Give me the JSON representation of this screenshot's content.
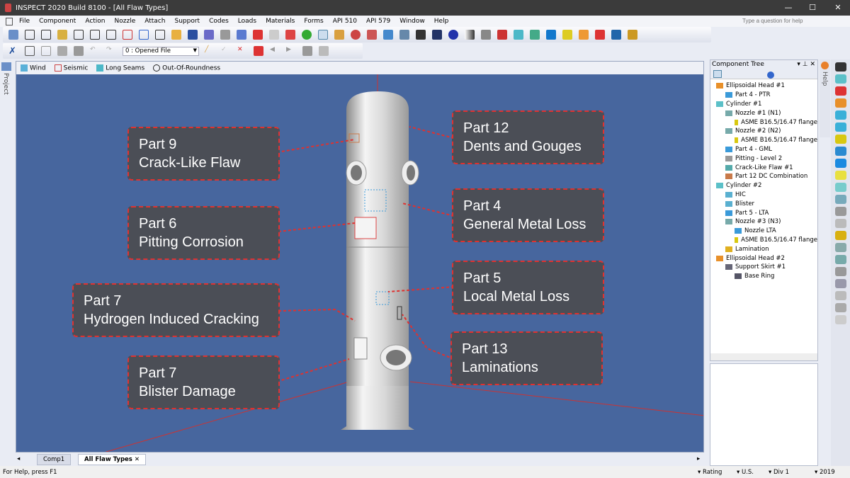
{
  "window": {
    "title": "INSPECT 2020 Build 8100 - [All Flaw Types]",
    "help_search_placeholder": "Type a question for help"
  },
  "menu": [
    "File",
    "Component",
    "Action",
    "Nozzle",
    "Attach",
    "Support",
    "Codes",
    "Loads",
    "Materials",
    "Forms",
    "API 510",
    "API 579",
    "Window",
    "Help"
  ],
  "toolbar2": {
    "history_select": "0 : Opened File"
  },
  "viewport_toolbar": [
    {
      "label": "Wind",
      "icon": "wind-icon"
    },
    {
      "label": "Seismic",
      "icon": "seismic-icon"
    },
    {
      "label": "Long Seams",
      "icon": "long-seams-icon"
    },
    {
      "label": "Out-Of-Roundness",
      "icon": "circle-icon"
    }
  ],
  "callouts": [
    {
      "part": "Part 9",
      "name": "Crack-Like Flaw"
    },
    {
      "part": "Part 12",
      "name": "Dents and Gouges"
    },
    {
      "part": "Part 6",
      "name": "Pitting Corrosion"
    },
    {
      "part": "Part 4",
      "name": "General Metal Loss"
    },
    {
      "part": "Part 7",
      "name": "Hydrogen Induced Cracking"
    },
    {
      "part": "Part 5",
      "name": "Local Metal Loss"
    },
    {
      "part": "Part 7",
      "name": "Blister Damage"
    },
    {
      "part": "Part 13",
      "name": "Laminations"
    }
  ],
  "side_labels": {
    "project": "Project",
    "help": "Help"
  },
  "component_tree": {
    "title": "Component Tree",
    "nodes": [
      {
        "label": "Ellipsoidal Head #1",
        "level": 0,
        "color": "#e8902a"
      },
      {
        "label": "Part 4 - PTR",
        "level": 1,
        "color": "#3a9ad9"
      },
      {
        "label": "Cylinder #1",
        "level": 0,
        "color": "#5cc0c8"
      },
      {
        "label": "Nozzle #1 (N1)",
        "level": 1,
        "color": "#7aa"
      },
      {
        "label": "ASME B16.5/16.47 flange",
        "level": 2,
        "color": "#d8c810"
      },
      {
        "label": "Nozzle #2 (N2)",
        "level": 1,
        "color": "#7aa"
      },
      {
        "label": "ASME B16.5/16.47 flange",
        "level": 2,
        "color": "#d8c810"
      },
      {
        "label": "Part 4 - GML",
        "level": 1,
        "color": "#3a9ad9"
      },
      {
        "label": "Pitting - Level 2",
        "level": 1,
        "color": "#999"
      },
      {
        "label": "Crack-Like Flaw #1",
        "level": 1,
        "color": "#5aa"
      },
      {
        "label": "Part 12 DC Combination",
        "level": 1,
        "color": "#c87a4a"
      },
      {
        "label": "Cylinder #2",
        "level": 0,
        "color": "#5cc0c8"
      },
      {
        "label": "HIC",
        "level": 1,
        "color": "#5ab0d0"
      },
      {
        "label": "Blister",
        "level": 1,
        "color": "#5ab0d0"
      },
      {
        "label": "Part 5 - LTA",
        "level": 1,
        "color": "#3a9ad9"
      },
      {
        "label": "Nozzle #3 (N3)",
        "level": 1,
        "color": "#7aa"
      },
      {
        "label": "Nozzle LTA",
        "level": 2,
        "color": "#3a9ad9"
      },
      {
        "label": "ASME B16.5/16.47 flange",
        "level": 2,
        "color": "#d8c810"
      },
      {
        "label": "Lamination",
        "level": 1,
        "color": "#e0b020"
      },
      {
        "label": "Ellipsoidal Head #2",
        "level": 0,
        "color": "#e8902a"
      },
      {
        "label": "Support Skirt #1",
        "level": 1,
        "color": "#667"
      },
      {
        "label": "Base Ring",
        "level": 2,
        "color": "#556"
      }
    ]
  },
  "tabs": [
    {
      "label": "Comp1",
      "active": false
    },
    {
      "label": "All Flaw Types",
      "active": true,
      "close": "✕"
    }
  ],
  "status": {
    "help": "For Help, press F1",
    "items": [
      "Rating",
      "U.S.",
      "Div 1",
      "2019"
    ]
  }
}
